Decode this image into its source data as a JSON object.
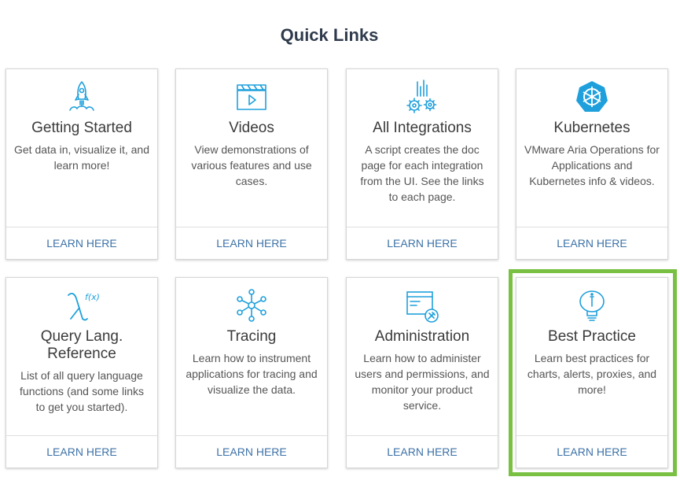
{
  "page": {
    "title": "Quick Links"
  },
  "cards": [
    {
      "name": "Getting Started",
      "desc": "Get data in, visualize it, and learn more!",
      "link": "LEARN HERE",
      "icon": "rocket-icon"
    },
    {
      "name": "Videos",
      "desc": "View demonstrations of various features and use cases.",
      "link": "LEARN HERE",
      "icon": "video-clapper-icon"
    },
    {
      "name": "All Integrations",
      "desc": "A script creates the doc page for each integration from the UI. See the links to each page.",
      "link": "LEARN HERE",
      "icon": "integrations-gears-icon"
    },
    {
      "name": "Kubernetes",
      "desc": "VMware Aria Operations for Applications and Kubernetes info & videos.",
      "link": "LEARN HERE",
      "icon": "kubernetes-icon"
    },
    {
      "name": "Query Lang. Reference",
      "desc": "List of all query language functions (and some links to get you started).",
      "link": "LEARN HERE",
      "icon": "function-icon"
    },
    {
      "name": "Tracing",
      "desc": "Learn how to instrument applications for tracing and visualize the data.",
      "link": "LEARN HERE",
      "icon": "tracing-nodes-icon"
    },
    {
      "name": "Administration",
      "desc": "Learn how to administer users and permissions, and monitor your product service.",
      "link": "LEARN HERE",
      "icon": "admin-window-icon"
    },
    {
      "name": "Best Practice",
      "desc": "Learn best practices for charts, alerts, proxies, and more!",
      "link": "LEARN HERE",
      "icon": "lightbulb-icon"
    }
  ],
  "colors": {
    "accent": "#1fa0dc",
    "link": "#3d72a8",
    "highlight": "#7ac143"
  }
}
